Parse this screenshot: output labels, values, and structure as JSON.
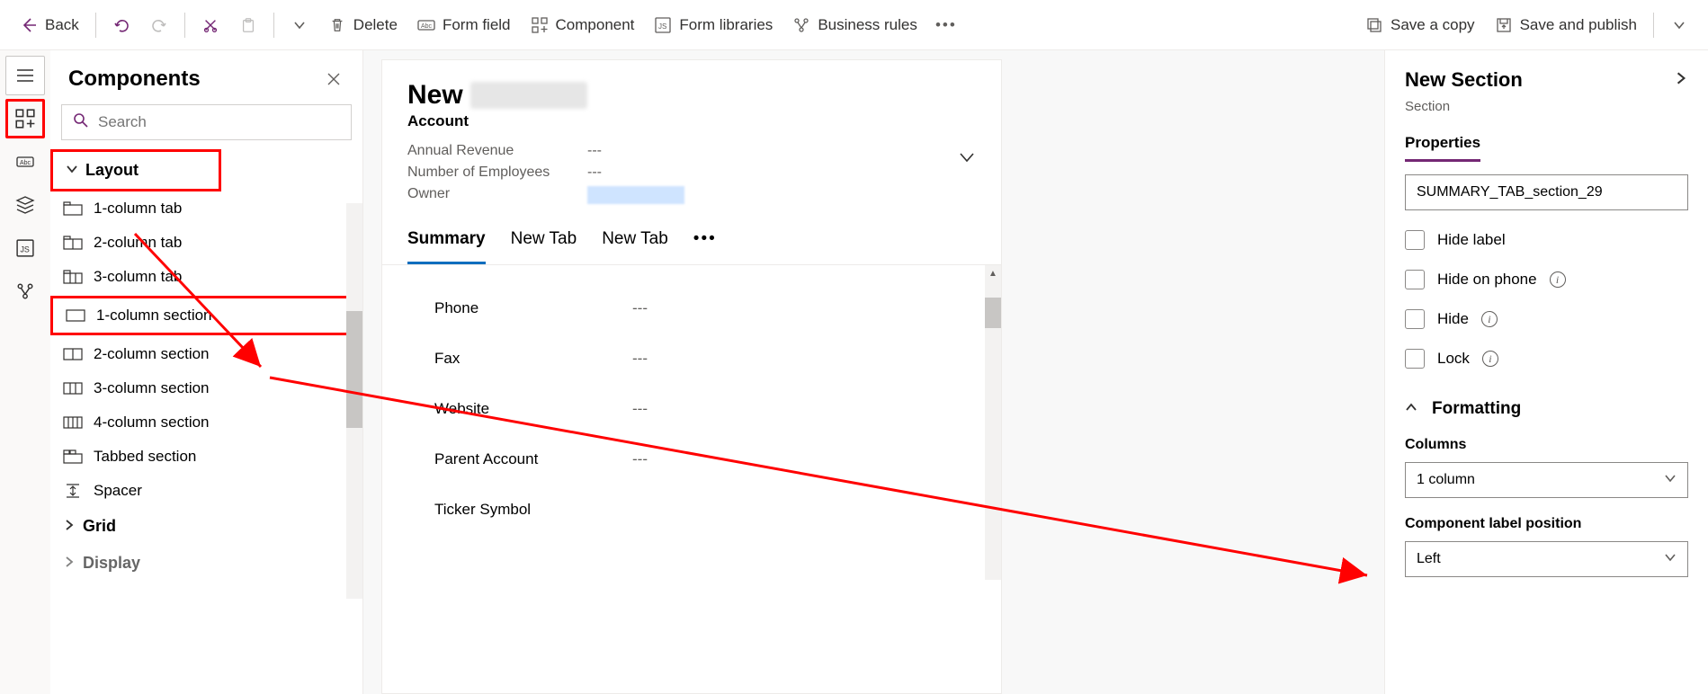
{
  "toolbar": {
    "back": "Back",
    "delete": "Delete",
    "form_field": "Form field",
    "component": "Component",
    "form_libraries": "Form libraries",
    "business_rules": "Business rules",
    "save_copy": "Save a copy",
    "save_publish": "Save and publish"
  },
  "components": {
    "title": "Components",
    "search_placeholder": "Search",
    "layout_head": "Layout",
    "items": [
      "1-column tab",
      "2-column tab",
      "3-column tab",
      "1-column section",
      "2-column section",
      "3-column section",
      "4-column section",
      "Tabbed section",
      "Spacer"
    ],
    "grid_head": "Grid",
    "display_head": "Display"
  },
  "form": {
    "title_prefix": "New",
    "entity": "Account",
    "meta": [
      {
        "label": "Annual Revenue",
        "value": "---"
      },
      {
        "label": "Number of Employees",
        "value": "---"
      },
      {
        "label": "Owner",
        "value": ""
      }
    ],
    "tabs": [
      "Summary",
      "New Tab",
      "New Tab"
    ],
    "fields": [
      {
        "label": "Phone",
        "value": "---"
      },
      {
        "label": "Fax",
        "value": "---"
      },
      {
        "label": "Website",
        "value": "---"
      },
      {
        "label": "Parent Account",
        "value": "---"
      },
      {
        "label": "Ticker Symbol",
        "value": ""
      }
    ]
  },
  "props": {
    "title": "New Section",
    "subtitle": "Section",
    "tab": "Properties",
    "name_value": "SUMMARY_TAB_section_29",
    "checks": {
      "hide_label": "Hide label",
      "hide_phone": "Hide on phone",
      "hide": "Hide",
      "lock": "Lock"
    },
    "formatting": "Formatting",
    "columns_label": "Columns",
    "columns_value": "1 column",
    "labelpos_label": "Component label position",
    "labelpos_value": "Left"
  }
}
